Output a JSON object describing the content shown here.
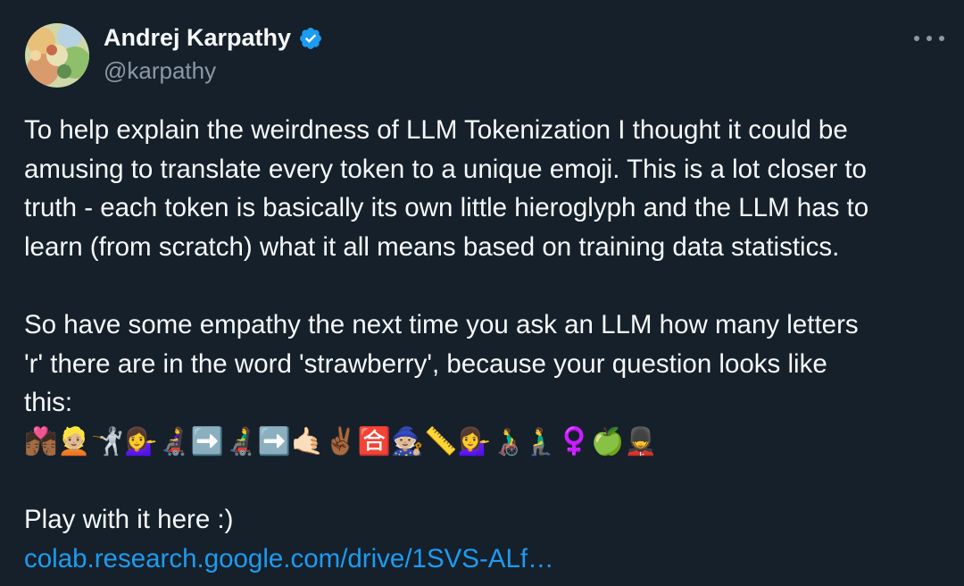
{
  "author": {
    "name": "Andrej Karpathy",
    "handle": "@karpathy",
    "verified": true
  },
  "menu": {
    "icon": "more-horizontal-icon"
  },
  "tweet": {
    "paragraph1_lines": [
      "To help explain the weirdness of LLM Tokenization I thought it could be",
      "amusing to translate every token to a unique emoji. This is a lot closer to",
      "truth - each token is basically its own little hieroglyph and the LLM has to",
      "learn (from scratch) what it all means based on training data statistics."
    ],
    "paragraph2_lines": [
      "So have some empathy the next time you ask an LLM how many letters",
      "'r' there are in the word 'strawberry', because your question looks like",
      "this:"
    ],
    "emoji_tokens": "💏🏾👱🏼🤺💁‍♀️👩‍🦼➡️👨‍🦼➡️🤙🏻✌🏾🈴🧙🏼📏💁‍♀️👨‍🦽🧎‍♂️♀️🍏💂",
    "play_text": "Play with it here :)",
    "link_text": "colab.research.google.com/drive/1SVS-ALf…"
  },
  "colors": {
    "background": "#15202b",
    "text": "#f7f9f9",
    "secondary": "#8b98a5",
    "link": "#1d9bf0",
    "verified": "#1d9bf0"
  }
}
